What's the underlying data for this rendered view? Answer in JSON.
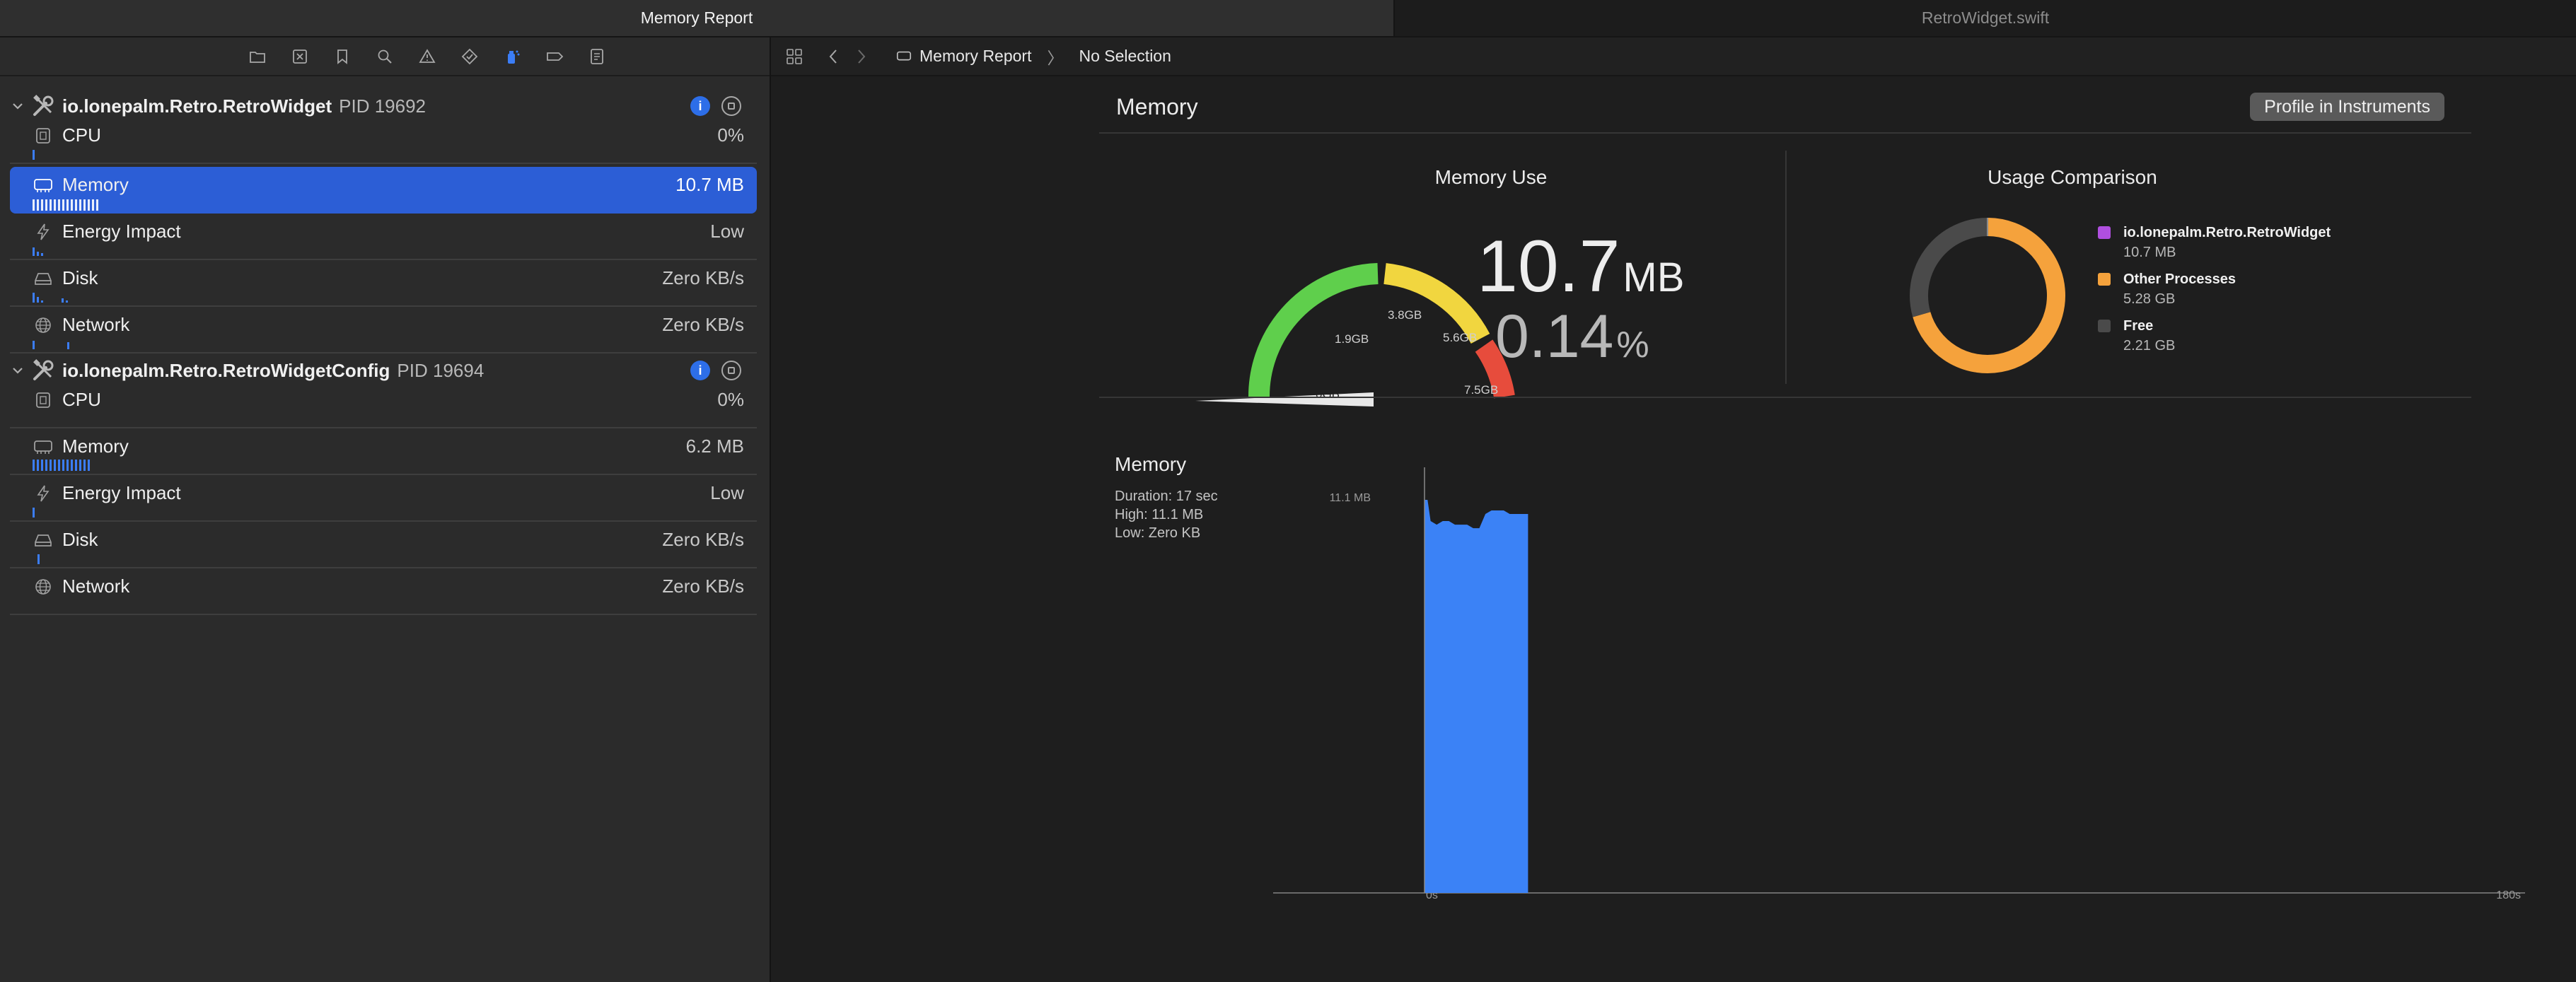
{
  "tabs": [
    {
      "label": "Memory Report",
      "active": true
    },
    {
      "label": "RetroWidget.swift",
      "active": false
    }
  ],
  "navigator": {
    "toolbar_icons": [
      "folder-icon",
      "x-square-icon",
      "bookmark-icon",
      "magnifier-icon",
      "warning-icon",
      "diamond-icon",
      "debug-spray-icon",
      "breakpoint-icon",
      "report-icon"
    ],
    "processes": [
      {
        "name": "io.lonepalm.Retro.RetroWidget",
        "pid": "PID 19692",
        "gauges": [
          {
            "label": "CPU",
            "value": "0%",
            "icon": "cpu-icon",
            "selected": false
          },
          {
            "label": "Memory",
            "value": "10.7 MB",
            "icon": "memory-icon",
            "selected": true
          },
          {
            "label": "Energy Impact",
            "value": "Low",
            "icon": "bolt-icon",
            "selected": false
          },
          {
            "label": "Disk",
            "value": "Zero KB/s",
            "icon": "disk-icon",
            "selected": false
          },
          {
            "label": "Network",
            "value": "Zero KB/s",
            "icon": "globe-icon",
            "selected": false
          }
        ]
      },
      {
        "name": "io.lonepalm.Retro.RetroWidgetConfig",
        "pid": "PID 19694",
        "gauges": [
          {
            "label": "CPU",
            "value": "0%",
            "icon": "cpu-icon",
            "selected": false
          },
          {
            "label": "Memory",
            "value": "6.2 MB",
            "icon": "memory-icon",
            "selected": false
          },
          {
            "label": "Energy Impact",
            "value": "Low",
            "icon": "bolt-icon",
            "selected": false
          },
          {
            "label": "Disk",
            "value": "Zero KB/s",
            "icon": "disk-icon",
            "selected": false
          },
          {
            "label": "Network",
            "value": "Zero KB/s",
            "icon": "globe-icon",
            "selected": false
          }
        ]
      }
    ]
  },
  "jumpbar": {
    "breadcrumb": [
      "Memory Report",
      "No Selection"
    ]
  },
  "report": {
    "title": "Memory",
    "profile_button": "Profile in Instruments",
    "memory_use": {
      "title": "Memory Use",
      "value": "10.7",
      "unit": "MB",
      "percent": "0.14",
      "percent_unit": "%",
      "gauge_labels": [
        "0GB",
        "1.9GB",
        "3.8GB",
        "5.6GB",
        "7.5GB"
      ],
      "gauge_colors": [
        "#5fcf4c",
        "#f1d63f",
        "#e74c3c"
      ]
    },
    "usage_comparison": {
      "title": "Usage Comparison",
      "items": [
        {
          "name": "io.lonepalm.Retro.RetroWidget",
          "value": "10.7 MB",
          "color": "#b04fe0",
          "gb": 0.0107
        },
        {
          "name": "Other Processes",
          "value": "5.28 GB",
          "color": "#f5a23c",
          "gb": 5.28
        },
        {
          "name": "Free",
          "value": "2.21 GB",
          "color": "#4a4a4a",
          "gb": 2.21
        }
      ]
    },
    "graph": {
      "title": "Memory",
      "stats": [
        "Duration: 17 sec",
        "High: 11.1 MB",
        "Low: Zero KB"
      ],
      "y_label": "11.1 MB",
      "x_start": "0s",
      "x_end": "180s"
    }
  },
  "chart_data": {
    "type": "area",
    "title": "Memory",
    "x": [
      0,
      0.5,
      1,
      2,
      3,
      4,
      5,
      6,
      7,
      8,
      9,
      10,
      11,
      12,
      13,
      14,
      15,
      16,
      17
    ],
    "series": [
      {
        "values": [
          11.1,
          11.1,
          10.5,
          10.4,
          10.5,
          10.5,
          10.4,
          10.4,
          10.4,
          10.3,
          10.3,
          10.7,
          10.8,
          10.8,
          10.8,
          10.7,
          10.7,
          10.7,
          10.7
        ]
      }
    ],
    "xlim": [
      0,
      180
    ],
    "ylim": [
      0,
      11.1
    ],
    "xlabel": "",
    "ylabel": ""
  }
}
